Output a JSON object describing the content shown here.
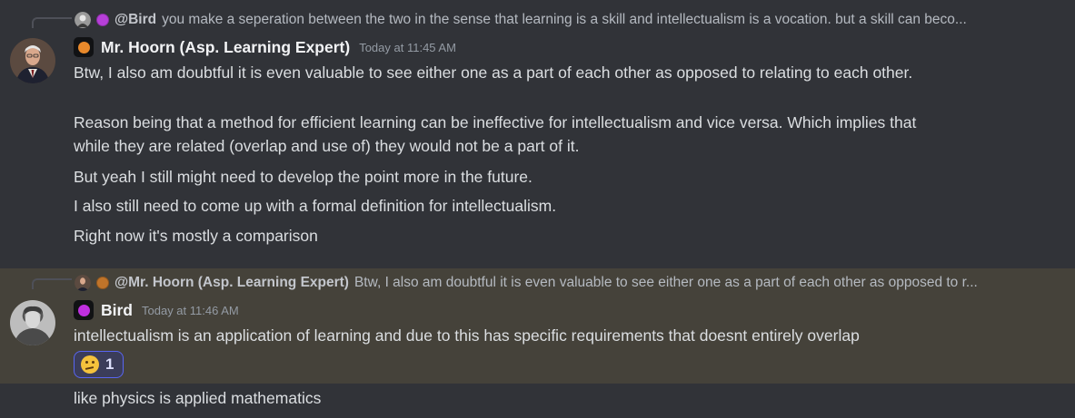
{
  "messages": [
    {
      "reply": {
        "dot_color": "#b63fd8",
        "name": "@Bird",
        "text": "you make a seperation between the two in the sense that learning is a skill and intellectualism is a vocation. but a skill can beco..."
      },
      "author": "Mr. Hoorn (Asp. Learning Expert)",
      "role_color": "#e8892b",
      "timestamp": "Today at 11:45 AM",
      "lines": [
        "Btw, I also am doubtful it is even valuable to see either one as a part of each other as opposed to relating to each other.",
        "Reason being that a method for efficient learning can be ineffective for intellectualism and vice versa. Which implies that",
        "while they are related (overlap and use of) they would not be a part of it.",
        "But yeah I still might need to develop the point more in the future.",
        "I also still need to come up with a formal definition for intellectualism.",
        "Right now it's mostly a comparison"
      ]
    },
    {
      "reply": {
        "dot_color": "#c0742a",
        "name": "@Mr. Hoorn (Asp. Learning Expert)",
        "text": "Btw, I also am doubtful it is even valuable to see either one as a part of each other as opposed to r..."
      },
      "author": "Bird",
      "role_color": "#c02fe0",
      "timestamp": "Today at 11:46 AM",
      "lines": [
        "intellectualism is an application of learning and due to this has specific requirements that doesnt entirely overlap"
      ],
      "reaction": {
        "emoji": "thinking-face",
        "count": "1"
      },
      "followup": "like physics is applied mathematics"
    }
  ]
}
